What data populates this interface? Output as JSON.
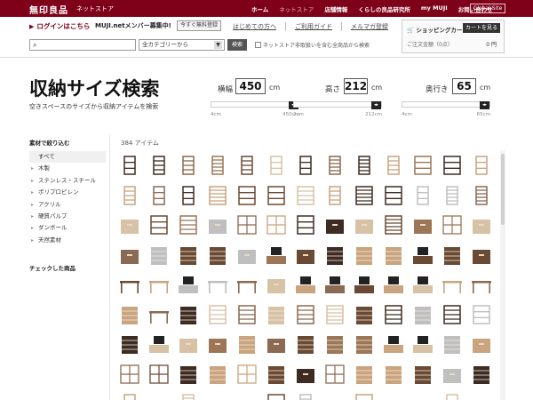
{
  "header": {
    "logo": "無印良品",
    "logo_sub": "ネットストア",
    "nav": [
      {
        "label": "ホーム",
        "dim": false
      },
      {
        "label": "ネットストア",
        "dim": true
      },
      {
        "label": "店舗情報",
        "dim": false
      },
      {
        "label": "くらしの良品研究所",
        "dim": false
      },
      {
        "label": "my MUJI",
        "dim": false
      },
      {
        "label": "お問い合わせ",
        "dim": false
      }
    ],
    "global_site": "Global Site",
    "brand_color": "#7f0019"
  },
  "subheader": {
    "login": "ログインはこちら",
    "member_text": "MUJI.netメンバー募集中!",
    "member_button": "今すぐ無料登録",
    "links": [
      "はじめての方へ",
      "ご利用ガイド",
      "メルマガ登録"
    ]
  },
  "cart": {
    "title": "ショッピングカート",
    "button": "カートを見る",
    "order_label": "ご注文金額（0点）",
    "amount": "0 円"
  },
  "search": {
    "input_value": "",
    "category": "全カテゴリーから",
    "button": "検索",
    "nonstore_label": "ネットストア非取扱いを含む全商品から検索"
  },
  "page": {
    "title": "収納サイズ検索",
    "description": "空きスペースのサイズから収納アイテムを検索"
  },
  "dimensions": [
    {
      "key": "width",
      "label": "横幅",
      "value": "450",
      "unit": "cm",
      "min": "4cm",
      "max": "450cm",
      "fraction": 1.0
    },
    {
      "key": "height",
      "label": "高さ",
      "value": "212",
      "unit": "cm",
      "min": "2cm",
      "max": "212cm",
      "fraction": 1.0
    },
    {
      "key": "depth",
      "label": "奥行き",
      "value": "65",
      "unit": "cm",
      "min": "4cm",
      "max": "65cm",
      "fraction": 1.0
    }
  ],
  "sidebar": {
    "filter_heading": "素材で絞り込む",
    "items": [
      {
        "label": "すべて",
        "active": true
      },
      {
        "label": "木製",
        "active": false
      },
      {
        "label": "ステンレス・スチール",
        "active": false
      },
      {
        "label": "ポリプロピレン",
        "active": false
      },
      {
        "label": "アクリル",
        "active": false
      },
      {
        "label": "硬質パルプ",
        "active": false
      },
      {
        "label": "ダンボール",
        "active": false
      },
      {
        "label": "天然素材",
        "active": false
      }
    ],
    "checked_heading": "チェックした商品"
  },
  "results": {
    "count_label": "384 アイテム"
  },
  "icons": {
    "search": "search-icon",
    "chevron": "chevron-down-icon",
    "cart": "cart-icon",
    "slider_thumb": "slider-thumb-icon"
  }
}
